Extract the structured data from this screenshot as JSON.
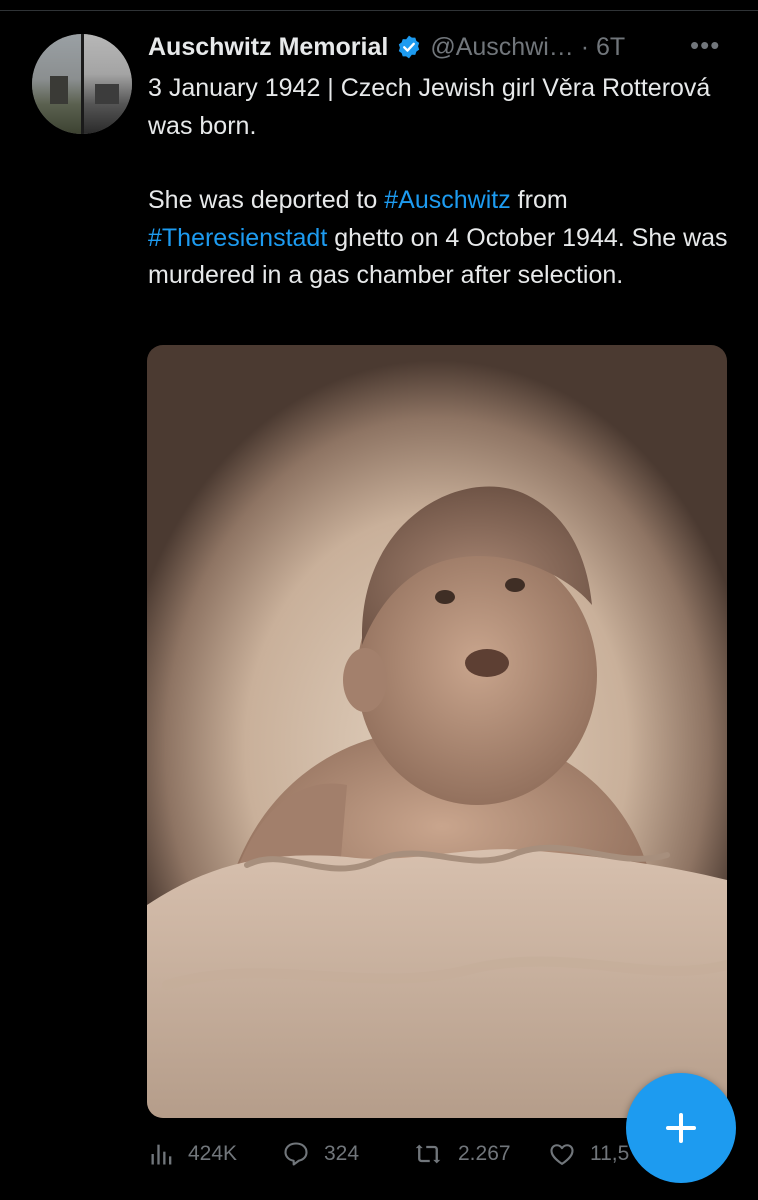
{
  "tweet": {
    "author_name": "Auschwitz Memorial",
    "handle_time": "@Auschwi… · 6T",
    "line1": "3 January 1942 | Czech Jewish girl Věra Rotterová was born.",
    "para2_a": "She was deported to ",
    "hashtag1": "#Auschwitz",
    "para2_b": " from",
    "hashtag2": "#Theresienstadt",
    "para2_c": " ghetto on 4 October 1944. She was murdered in a gas chamber after selection."
  },
  "stats": {
    "views": "424K",
    "replies": "324",
    "retweets": "2.267",
    "likes": "11,5"
  },
  "icons": {
    "verified": "verified-badge-icon",
    "more": "more-options-icon",
    "views": "views-icon",
    "reply": "reply-icon",
    "retweet": "retweet-icon",
    "like": "heart-icon",
    "compose": "plus-icon"
  },
  "colors": {
    "accent": "#1d9bf0",
    "muted": "#71767b",
    "text": "#e7e9ea"
  }
}
